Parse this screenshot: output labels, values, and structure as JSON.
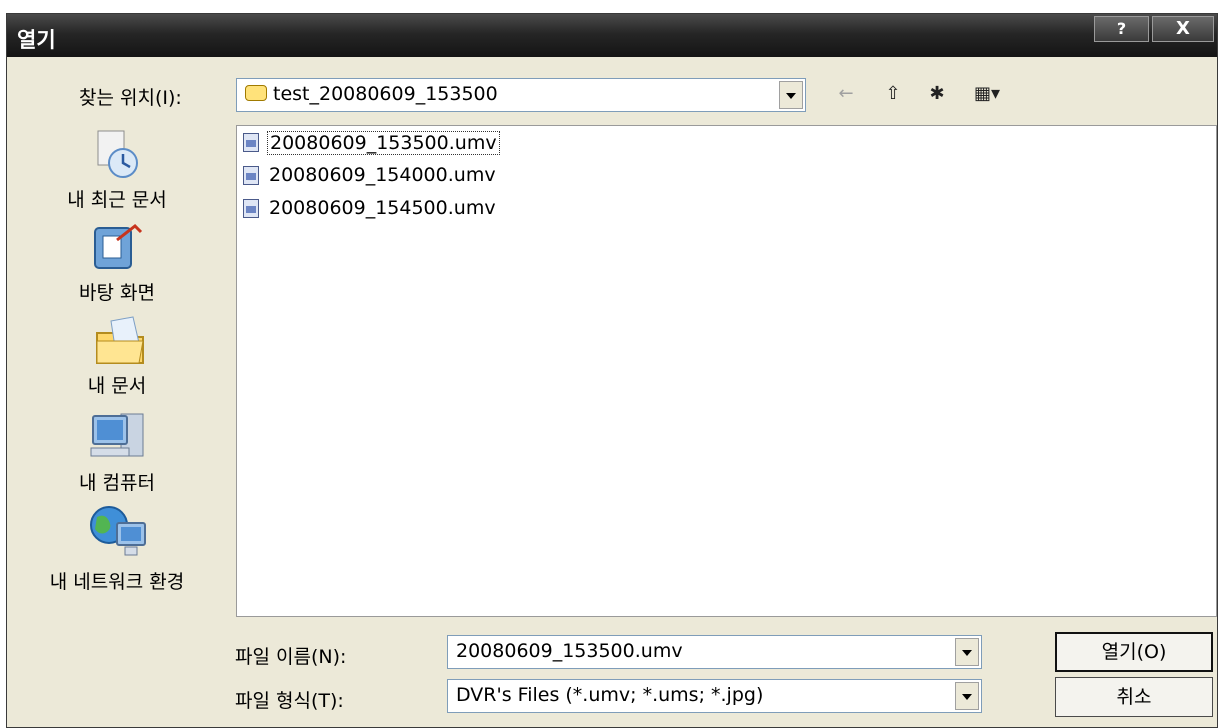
{
  "title": "열기",
  "titlebar_buttons": {
    "help": "?",
    "close": "X"
  },
  "toolbar": {
    "look_in_label": "찾는 위치(I):",
    "look_in_value": "test_20080609_153500",
    "back_glyph": "←",
    "up_glyph": "⇧",
    "new_folder_glyph": "✱",
    "view_glyph": "▦▾"
  },
  "places": [
    {
      "label": "내 최근 문서",
      "icon": "recent-documents-icon"
    },
    {
      "label": "바탕 화면",
      "icon": "desktop-icon"
    },
    {
      "label": "내 문서",
      "icon": "my-documents-icon"
    },
    {
      "label": "내 컴퓨터",
      "icon": "my-computer-icon"
    },
    {
      "label": "내 네트워크 환경",
      "icon": "my-network-icon"
    }
  ],
  "files": [
    {
      "name": "20080609_153500.umv",
      "selected": true
    },
    {
      "name": "20080609_154000.umv",
      "selected": false
    },
    {
      "name": "20080609_154500.umv",
      "selected": false
    }
  ],
  "filename": {
    "label": "파일 이름(N):",
    "value": "20080609_153500.umv"
  },
  "filetype": {
    "label": "파일 형식(T):",
    "value": "DVR's Files (*.umv; *.ums; *.jpg)"
  },
  "buttons": {
    "open": "열기(O)",
    "cancel": "취소"
  }
}
